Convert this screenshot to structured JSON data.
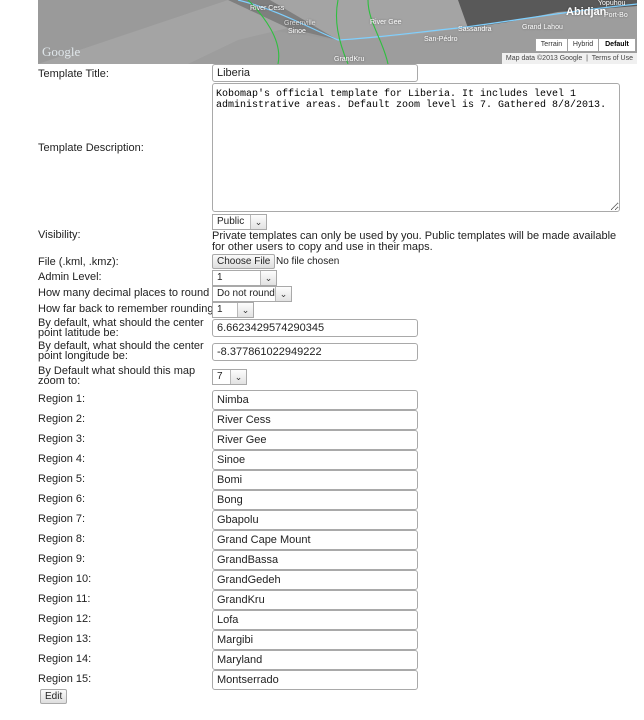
{
  "map": {
    "labels": [
      "River Cess",
      "Greenville",
      "Sinoe",
      "River Gee",
      "Sassandra",
      "San-Pédro",
      "Grand Lahou",
      "Abidjan",
      "Port-Bo",
      "Yopuhou",
      "GrandKru"
    ],
    "google_logo": "Google",
    "map_types": [
      "Terrain",
      "Hybrid",
      "Default"
    ],
    "selected_map_type": "Default",
    "attribution": [
      "Map data ©2013 Google",
      "Terms of Use"
    ]
  },
  "form": {
    "title_label": "Template Title:",
    "title_value": "Liberia",
    "description_label": "Template Description:",
    "description_value": "Kobomap's official template for Liberia. It includes level 1 administrative areas. Default zoom level is 7. Gathered 8/8/2013.",
    "visibility_label": "Visibility:",
    "visibility_value": "Public",
    "visibility_help": "Private templates can only be used by you. Public templates will be made available for other users to copy and use in their maps.",
    "file_label": "File (.kml, .kmz):",
    "file_button": "Choose File",
    "file_status": "No file chosen",
    "admin_label": "Admin Level:",
    "admin_value": "1",
    "decimal_label": "How many decimal places to round to:",
    "decimal_value": "Do not round",
    "rounding_label": "How far back to remember rounding:",
    "rounding_value": "1",
    "lat_label": "By default, what should the center point latitude be:",
    "lat_value": "6.6623429574290345",
    "lng_label": "By default, what should the center point longitude be:",
    "lng_value": "-8.377861022949222",
    "zoom_label": "By Default what should this map zoom to:",
    "zoom_value": "7",
    "regions": [
      {
        "label": "Region 1:",
        "value": "Nimba"
      },
      {
        "label": "Region 2:",
        "value": "River Cess"
      },
      {
        "label": "Region 3:",
        "value": "River Gee"
      },
      {
        "label": "Region 4:",
        "value": "Sinoe"
      },
      {
        "label": "Region 5:",
        "value": "Bomi"
      },
      {
        "label": "Region 6:",
        "value": "Bong"
      },
      {
        "label": "Region 7:",
        "value": "Gbapolu"
      },
      {
        "label": "Region 8:",
        "value": "Grand Cape Mount"
      },
      {
        "label": "Region 9:",
        "value": "GrandBassa"
      },
      {
        "label": "Region 10:",
        "value": "GrandGedeh"
      },
      {
        "label": "Region 11:",
        "value": "GrandKru"
      },
      {
        "label": "Region 12:",
        "value": "Lofa"
      },
      {
        "label": "Region 13:",
        "value": "Margibi"
      },
      {
        "label": "Region 14:",
        "value": "Maryland"
      },
      {
        "label": "Region 15:",
        "value": "Montserrado"
      }
    ],
    "edit_button": "Edit"
  }
}
